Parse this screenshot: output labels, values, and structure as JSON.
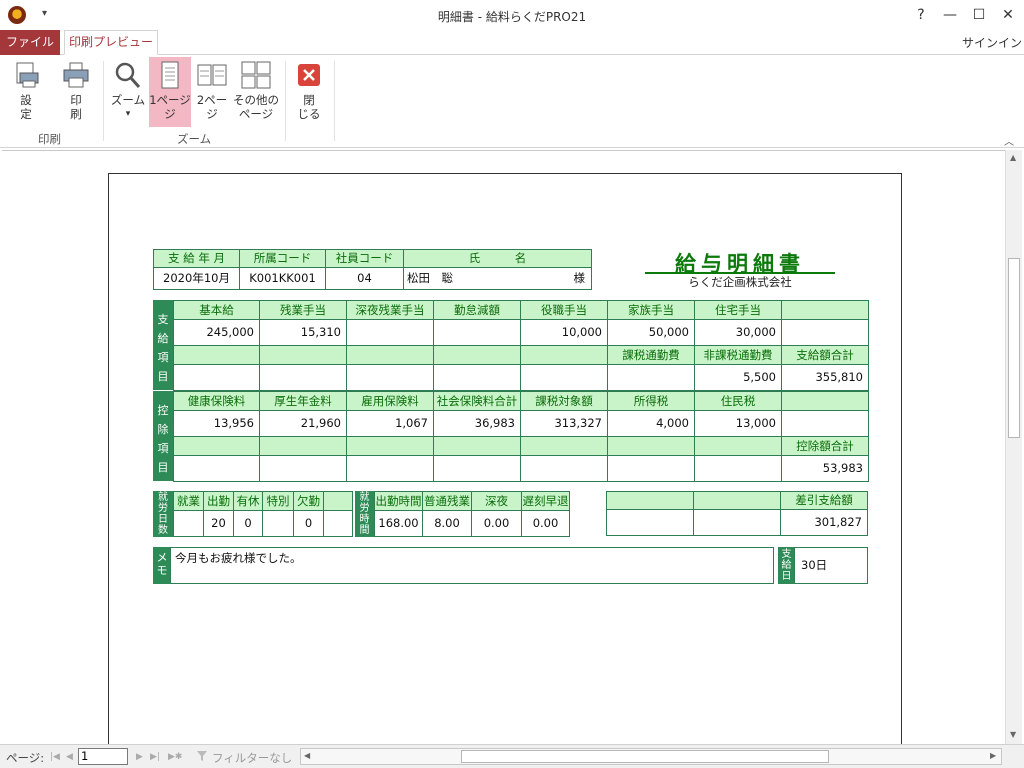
{
  "window": {
    "title": "明細書 - 給料らくだPRO21",
    "help": "?",
    "minimize": "—",
    "maximize": "☐",
    "close": "✕",
    "qat_glyph": "▾"
  },
  "tabs": {
    "file": "ファイル",
    "print_preview": "印刷プレビュー",
    "signin": "サインイン"
  },
  "ribbon": {
    "settings": [
      "設",
      "定"
    ],
    "print": [
      "印",
      "刷"
    ],
    "zoom": "ズーム",
    "one_page": [
      "1ページ",
      "ジ"
    ],
    "two_page": [
      "2ペー",
      "ジ"
    ],
    "other_pages": [
      "その他の",
      "ページ"
    ],
    "close": [
      "閉",
      "じる"
    ],
    "group_print": "印刷",
    "group_zoom": "ズーム",
    "dropdown_glyph": "▾",
    "collapse_glyph": "︿"
  },
  "slip": {
    "doc_title": "給与明細書",
    "company": "らくだ企画株式会社",
    "info_headers": [
      "支 給 年 月",
      "所属コード",
      "社員コード",
      "氏　　　名"
    ],
    "pay_month": "2020年10月",
    "dept_code": "K001KK001",
    "emp_code": "04",
    "name": "松田　聡",
    "honorific": "様",
    "pay_side": [
      "支",
      "給",
      "項",
      "目"
    ],
    "pay_headers1": [
      "基本給",
      "残業手当",
      "深夜残業手当",
      "勤怠減額",
      "役職手当",
      "家族手当",
      "住宅手当",
      ""
    ],
    "pay_values1": [
      "245,000",
      "15,310",
      "",
      "",
      "10,000",
      "50,000",
      "30,000",
      ""
    ],
    "pay_headers2": [
      "",
      "",
      "",
      "",
      "",
      "課税通勤費",
      "非課税通勤費",
      "支給額合計"
    ],
    "pay_values2": [
      "",
      "",
      "",
      "",
      "",
      "",
      "5,500",
      "355,810"
    ],
    "ded_side": [
      "控",
      "除",
      "項",
      "目"
    ],
    "ded_headers1": [
      "健康保険料",
      "厚生年金料",
      "雇用保険料",
      "社会保険料合計",
      "課税対象額",
      "所得税",
      "住民税",
      ""
    ],
    "ded_values1": [
      "13,956",
      "21,960",
      "1,067",
      "36,983",
      "313,327",
      "4,000",
      "13,000",
      ""
    ],
    "ded_headers2": [
      "",
      "",
      "",
      "",
      "",
      "",
      "",
      "控除額合計"
    ],
    "ded_values2": [
      "",
      "",
      "",
      "",
      "",
      "",
      "",
      "53,983"
    ],
    "att_side": [
      "就",
      "労",
      "日",
      "数"
    ],
    "att_headers": [
      "就業",
      "出勤",
      "有休",
      "特別",
      "欠勤",
      ""
    ],
    "att_values": [
      "",
      "20",
      "0",
      "",
      "0",
      ""
    ],
    "time_side": [
      "就",
      "労",
      "時",
      "間"
    ],
    "time_headers": [
      "出勤時間",
      "普通残業",
      "深夜",
      "遅刻早退"
    ],
    "time_values": [
      "168.00",
      "8.00",
      "0.00",
      "0.00"
    ],
    "net_header": "差引支給額",
    "net_value": "301,827",
    "memo_side": [
      "メ",
      "モ"
    ],
    "memo_text": "今月もお疲れ様でした。",
    "payday_side": [
      "支",
      "給",
      "日"
    ],
    "payday_value": "30日"
  },
  "statusbar": {
    "page_label": "ページ:",
    "page_value": "1",
    "filter": "フィルターなし",
    "nav_first": "|◀",
    "nav_prev": "◀",
    "nav_next": "▶",
    "nav_last": "▶|",
    "nav_new": "▶✱",
    "scroll_left": "◀",
    "scroll_right": "▶"
  }
}
